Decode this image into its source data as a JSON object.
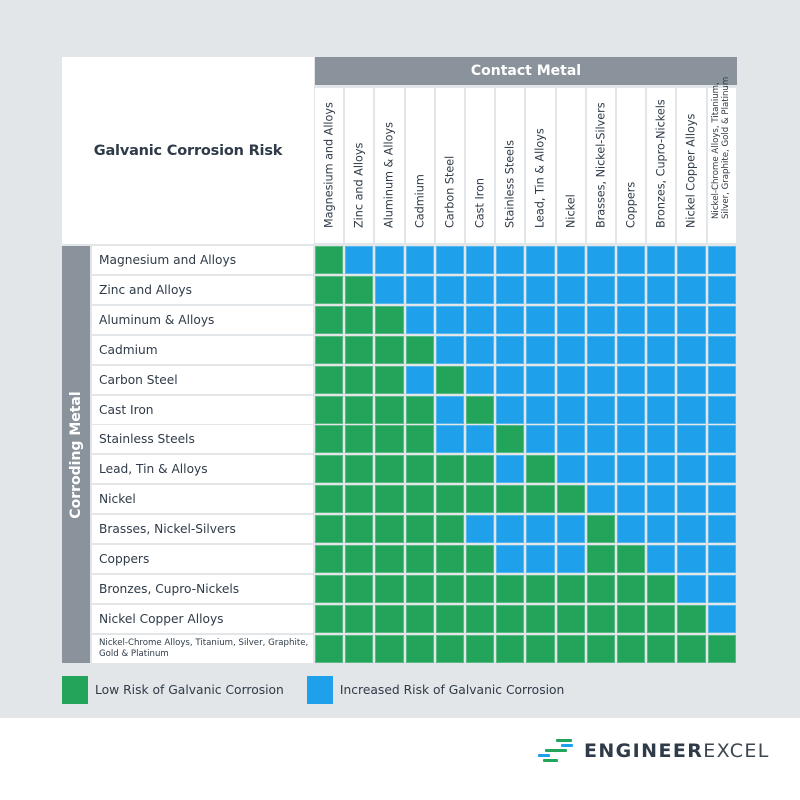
{
  "colors": {
    "low_risk": "#22a45a",
    "increased_risk": "#1fa0ea",
    "header_bg": "#8a939b",
    "background": "#e2e6e9",
    "logo_green": "#22a45a",
    "logo_blue": "#1fa0ea"
  },
  "chart_data": {
    "type": "heatmap",
    "title": "Galvanic Corrosion Risk",
    "xlabel": "Contact Metal",
    "ylabel": "Corroding Metal",
    "x_categories": [
      "Magnesium and Alloys",
      "Zinc and Alloys",
      "Aluminum & Alloys",
      "Cadmium",
      "Carbon Steel",
      "Cast Iron",
      "Stainless Steels",
      "Lead, Tin & Alloys",
      "Nickel",
      "Brasses, Nickel-Silvers",
      "Coppers",
      "Bronzes, Cupro-Nickels",
      "Nickel Copper Alloys",
      "Nickel-Chrome Alloys, Titanium, Silver, Graphite, Gold & Platinum"
    ],
    "y_categories": [
      "Magnesium and Alloys",
      "Zinc and Alloys",
      "Aluminum & Alloys",
      "Cadmium",
      "Carbon Steel",
      "Cast Iron",
      "Stainless Steels",
      "Lead, Tin & Alloys",
      "Nickel",
      "Brasses, Nickel-Silvers",
      "Coppers",
      "Bronzes, Cupro-Nickels",
      "Nickel Copper Alloys",
      "Nickel-Chrome Alloys, Titanium, Silver, Graphite, Gold & Platinum"
    ],
    "value_legend": {
      "L": "Low Risk of Galvanic Corrosion",
      "I": "Increased Risk of Galvanic Corrosion"
    },
    "values": [
      [
        "L",
        "I",
        "I",
        "I",
        "I",
        "I",
        "I",
        "I",
        "I",
        "I",
        "I",
        "I",
        "I",
        "I"
      ],
      [
        "L",
        "L",
        "I",
        "I",
        "I",
        "I",
        "I",
        "I",
        "I",
        "I",
        "I",
        "I",
        "I",
        "I"
      ],
      [
        "L",
        "L",
        "L",
        "I",
        "I",
        "I",
        "I",
        "I",
        "I",
        "I",
        "I",
        "I",
        "I",
        "I"
      ],
      [
        "L",
        "L",
        "L",
        "L",
        "I",
        "I",
        "I",
        "I",
        "I",
        "I",
        "I",
        "I",
        "I",
        "I"
      ],
      [
        "L",
        "L",
        "L",
        "I",
        "L",
        "I",
        "I",
        "I",
        "I",
        "I",
        "I",
        "I",
        "I",
        "I"
      ],
      [
        "L",
        "L",
        "L",
        "L",
        "I",
        "L",
        "I",
        "I",
        "I",
        "I",
        "I",
        "I",
        "I",
        "I"
      ],
      [
        "L",
        "L",
        "L",
        "L",
        "I",
        "I",
        "L",
        "I",
        "I",
        "I",
        "I",
        "I",
        "I",
        "I"
      ],
      [
        "L",
        "L",
        "L",
        "L",
        "L",
        "L",
        "I",
        "L",
        "I",
        "I",
        "I",
        "I",
        "I",
        "I"
      ],
      [
        "L",
        "L",
        "L",
        "L",
        "L",
        "L",
        "L",
        "L",
        "L",
        "I",
        "I",
        "I",
        "I",
        "I"
      ],
      [
        "L",
        "L",
        "L",
        "L",
        "L",
        "I",
        "I",
        "I",
        "I",
        "L",
        "I",
        "I",
        "I",
        "I"
      ],
      [
        "L",
        "L",
        "L",
        "L",
        "L",
        "L",
        "I",
        "I",
        "I",
        "L",
        "L",
        "I",
        "I",
        "I"
      ],
      [
        "L",
        "L",
        "L",
        "L",
        "L",
        "L",
        "L",
        "L",
        "L",
        "L",
        "L",
        "L",
        "I",
        "I"
      ],
      [
        "L",
        "L",
        "L",
        "L",
        "L",
        "L",
        "L",
        "L",
        "L",
        "L",
        "L",
        "L",
        "L",
        "I"
      ],
      [
        "L",
        "L",
        "L",
        "L",
        "L",
        "L",
        "L",
        "L",
        "L",
        "L",
        "L",
        "L",
        "L",
        "L"
      ]
    ],
    "legend_position": "bottom-left"
  },
  "legend": {
    "low_label": "Low Risk of Galvanic Corrosion",
    "increased_label": "Increased Risk of Galvanic Corrosion"
  },
  "logo": {
    "bold_part": "ENGINEER",
    "light_part": "EXCEL",
    "icon": "stacked-lines-logo-icon"
  }
}
